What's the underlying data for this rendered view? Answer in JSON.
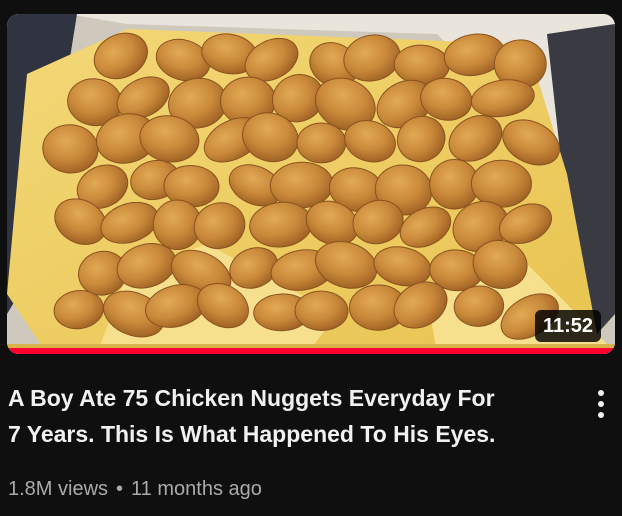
{
  "video": {
    "duration": "11:52",
    "watch_progress": 1.0,
    "progress_color": "#ff0033",
    "title_line_1": "A Boy Ate 75 Chicken Nuggets Everyday For",
    "title_line_2": "7 Years. This Is What Happened To His Eyes.",
    "views": "1.8M views",
    "separator": "•",
    "age": "11 months ago",
    "menu_icon": "more-vertical-icon"
  }
}
